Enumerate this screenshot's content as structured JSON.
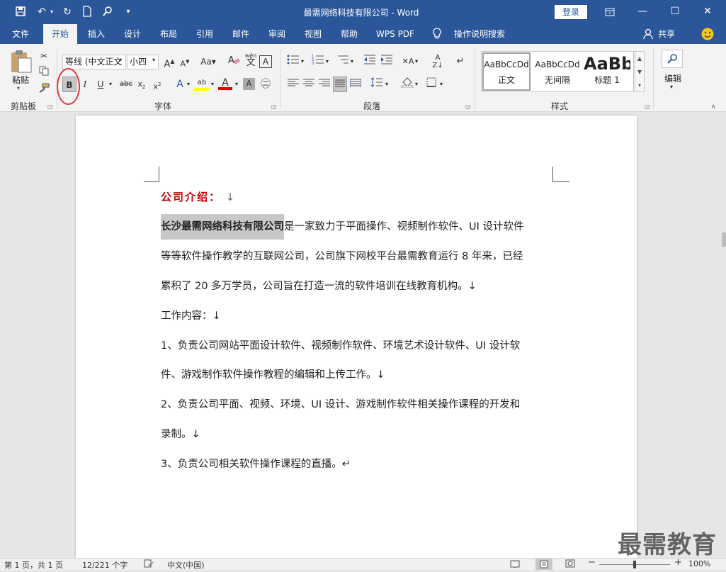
{
  "title_bar": {
    "title": "最需网络科技有限公司  -  Word",
    "login_label": "登录",
    "qa_icons": [
      "save-icon",
      "undo-icon",
      "redo-icon",
      "new-document-icon",
      "touch-mode-icon",
      "customize-quick-access-icon"
    ]
  },
  "tabs": [
    {
      "label": "文件"
    },
    {
      "label": "开始"
    },
    {
      "label": "插入"
    },
    {
      "label": "设计"
    },
    {
      "label": "布局"
    },
    {
      "label": "引用"
    },
    {
      "label": "邮件"
    },
    {
      "label": "审阅"
    },
    {
      "label": "视图"
    },
    {
      "label": "帮助"
    },
    {
      "label": "WPS PDF"
    },
    {
      "label": "操作说明搜索"
    }
  ],
  "share_label": "共享",
  "ribbon": {
    "clipboard": {
      "paste_label": "粘贴",
      "group_label": "剪贴板"
    },
    "font": {
      "font_name": "等线 (中文正文",
      "font_size": "小四",
      "group_label": "字体"
    },
    "paragraph": {
      "group_label": "段落"
    },
    "styles": {
      "group_label": "样式",
      "items": [
        {
          "preview": "AaBbCcDd",
          "label": "正文"
        },
        {
          "preview": "AaBbCcDd",
          "label": "无间隔"
        },
        {
          "preview": "AaBb",
          "label": "标题 1"
        }
      ]
    },
    "editing": {
      "label": "编辑"
    }
  },
  "document": {
    "heading": "公司介绍：",
    "p1_bold": "长沙最需网络科技有限公司",
    "p1_rest": "是一家致力于平面操作、视频制作软件、UI 设计软件",
    "p1_line2": "等等软件操作教学的互联网公司，公司旗下网校平台最需教育运行 8 年来，已经",
    "p1_line3": "累积了 20 多万学员，公司旨在打造一流的软件培训在线教育机构。↓",
    "work_heading": "工作内容：↓",
    "item1_line1": "1、负责公司网站平面设计软件、视频制作软件、环境艺术设计软件、UI 设计软",
    "item1_line2": "件、游戏制作软件操作教程的编辑和上传工作。↓",
    "item2_line1": "2、负责公司平面、视频、环境、UI 设计、游戏制作软件相关操作课程的开发和",
    "item2_line2": "录制。↓",
    "item3": "3、负责公司相关软件操作课程的直播。↵"
  },
  "status": {
    "page": "第 1 页，共 1 页",
    "words": "12/221 个字",
    "language": "中文(中国)",
    "zoom": "100%"
  },
  "watermark": "最需教育",
  "colors": {
    "brand": "#2b579a",
    "heading_red": "#c00000",
    "highlight": "#c8c8c8",
    "callout_red": "#e53935"
  }
}
